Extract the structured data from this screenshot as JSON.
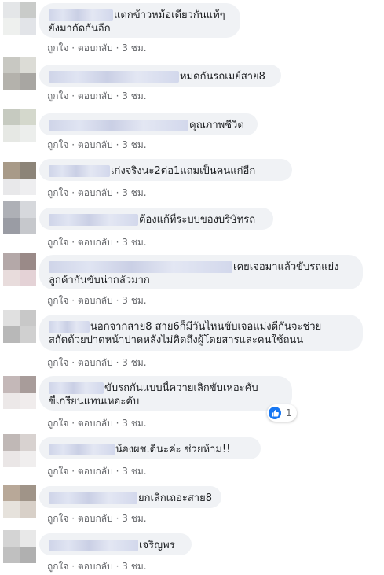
{
  "actions": {
    "like": "ถูกใจ",
    "reply": "ตอบกลับ",
    "time": "3 ชม.",
    "sep": "·"
  },
  "comments": [
    {
      "lines": [
        "แตกข้าวหม้อเดียวกันแท้ๆ",
        "ยังมากัดกันอีก"
      ]
    },
    {
      "lines": [
        "หมดกันรถเมย์สาย8"
      ]
    },
    {
      "lines": [
        "คุณภาพชีวิต"
      ]
    },
    {
      "lines": [
        "เก่งจริงนะ2ต่อ1แถมเป็นคนแก่อีก"
      ]
    },
    {
      "lines": [
        "ต้องแก้ที่ระบบของบริษัทรถ"
      ]
    },
    {
      "lines": [
        "เคยเจอมาแล้วขับรถแย่ง",
        "ลูกค้ากันขับน่ากลัวมาก"
      ]
    },
    {
      "lines": [
        "นอกจากสาย8 สาย6ก็มีวันไหนขับเจอแม่งตีกันจะช่วย",
        "สกัดด้วยปาดหน้าปาดหลังไม่คิดถึงผู้โดยสารและคนใช้ถนน"
      ]
    },
    {
      "lines": [
        "ขับรถกันแบบนี้ควายเลิกขับเหอะคับ",
        "ขี้เกรียนแทนเหอะคับ"
      ],
      "reaction_count": "1"
    },
    {
      "lines": [
        "น้องผช.ดีนะค่ะ ช่วยห้าม!!"
      ]
    },
    {
      "lines": [
        "ยกเลิกเถอะสาย8"
      ]
    },
    {
      "lines": [
        "เจริญพร"
      ]
    }
  ]
}
